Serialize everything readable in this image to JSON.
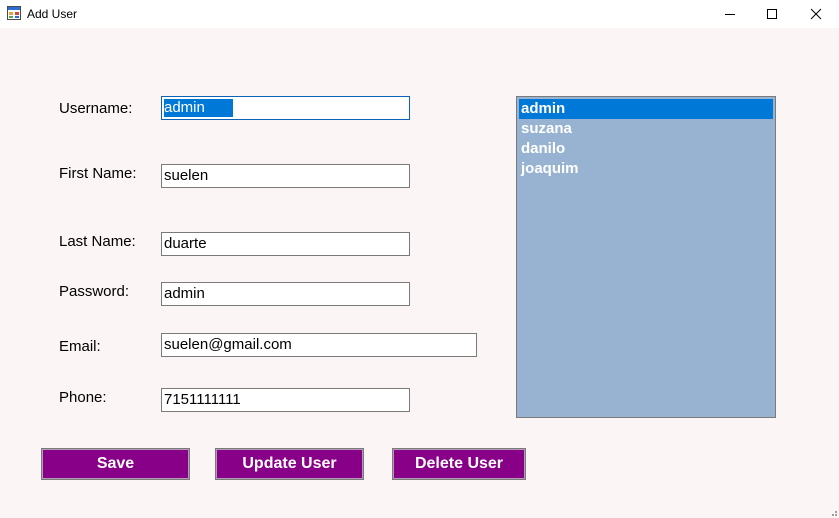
{
  "window": {
    "title": "Add User",
    "controls": {
      "minimize": "minimize",
      "maximize": "maximize",
      "close": "close"
    }
  },
  "form": {
    "username": {
      "label": "Username:",
      "value": "admin"
    },
    "first_name": {
      "label": "First Name:",
      "value": "suelen"
    },
    "last_name": {
      "label": "Last Name:",
      "value": "duarte"
    },
    "password": {
      "label": "Password:",
      "value": "admin"
    },
    "email": {
      "label": "Email:",
      "value": "suelen@gmail.com"
    },
    "phone": {
      "label": "Phone:",
      "value": "7151111111"
    }
  },
  "user_list": {
    "items": [
      "admin",
      "suzana",
      "danilo",
      "joaquim"
    ],
    "selected": "admin"
  },
  "buttons": {
    "save": "Save",
    "update": "Update User",
    "delete": "Delete User"
  },
  "colors": {
    "button_bg": "#880088",
    "list_bg": "#97b3d1",
    "selection": "#0078d7",
    "form_bg": "#fbf6f5"
  }
}
